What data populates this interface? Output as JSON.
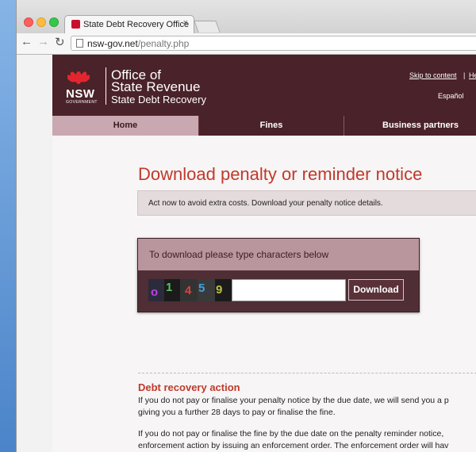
{
  "browser": {
    "tab_title": "State Debt Recovery Office",
    "tab_close": "×",
    "url_host": "nsw-gov.net",
    "url_path": "/penalty.php"
  },
  "header": {
    "logo_text": "NSW",
    "logo_subtext": "GOVERNMENT",
    "org_line1": "Office of",
    "org_line2": "State Revenue",
    "org_line3": "State Debt Recovery",
    "skip_link": "Skip to content",
    "separator": "|",
    "help_link": "Help",
    "language_link": "Español"
  },
  "nav": {
    "items": [
      "Home",
      "Fines",
      "Business partners"
    ]
  },
  "main": {
    "title": "Download penalty or reminder notice",
    "notice": "Act now to avoid extra costs. Download your penalty notice details.",
    "captcha_prompt": "To download please type characters below",
    "captcha_glyphs": [
      "o",
      "1",
      "4",
      "5",
      "9"
    ],
    "captcha_value": "",
    "download_label": "Download",
    "section_title": "Debt recovery action",
    "para1_line1": "If you do not pay or finalise your penalty notice by the due date, we will send you a p",
    "para1_line2": "giving you a further 28 days to pay or finalise the fine.",
    "para2_line1": "If you do not pay or finalise the fine by the due date on the penalty reminder notice,",
    "para2_line2": "enforcement action by issuing an enforcement order. The enforcement order will hav"
  },
  "colors": {
    "brand_maroon": "#4a2229",
    "title_red": "#c0392b",
    "nav_active": "#c9a8b1"
  }
}
